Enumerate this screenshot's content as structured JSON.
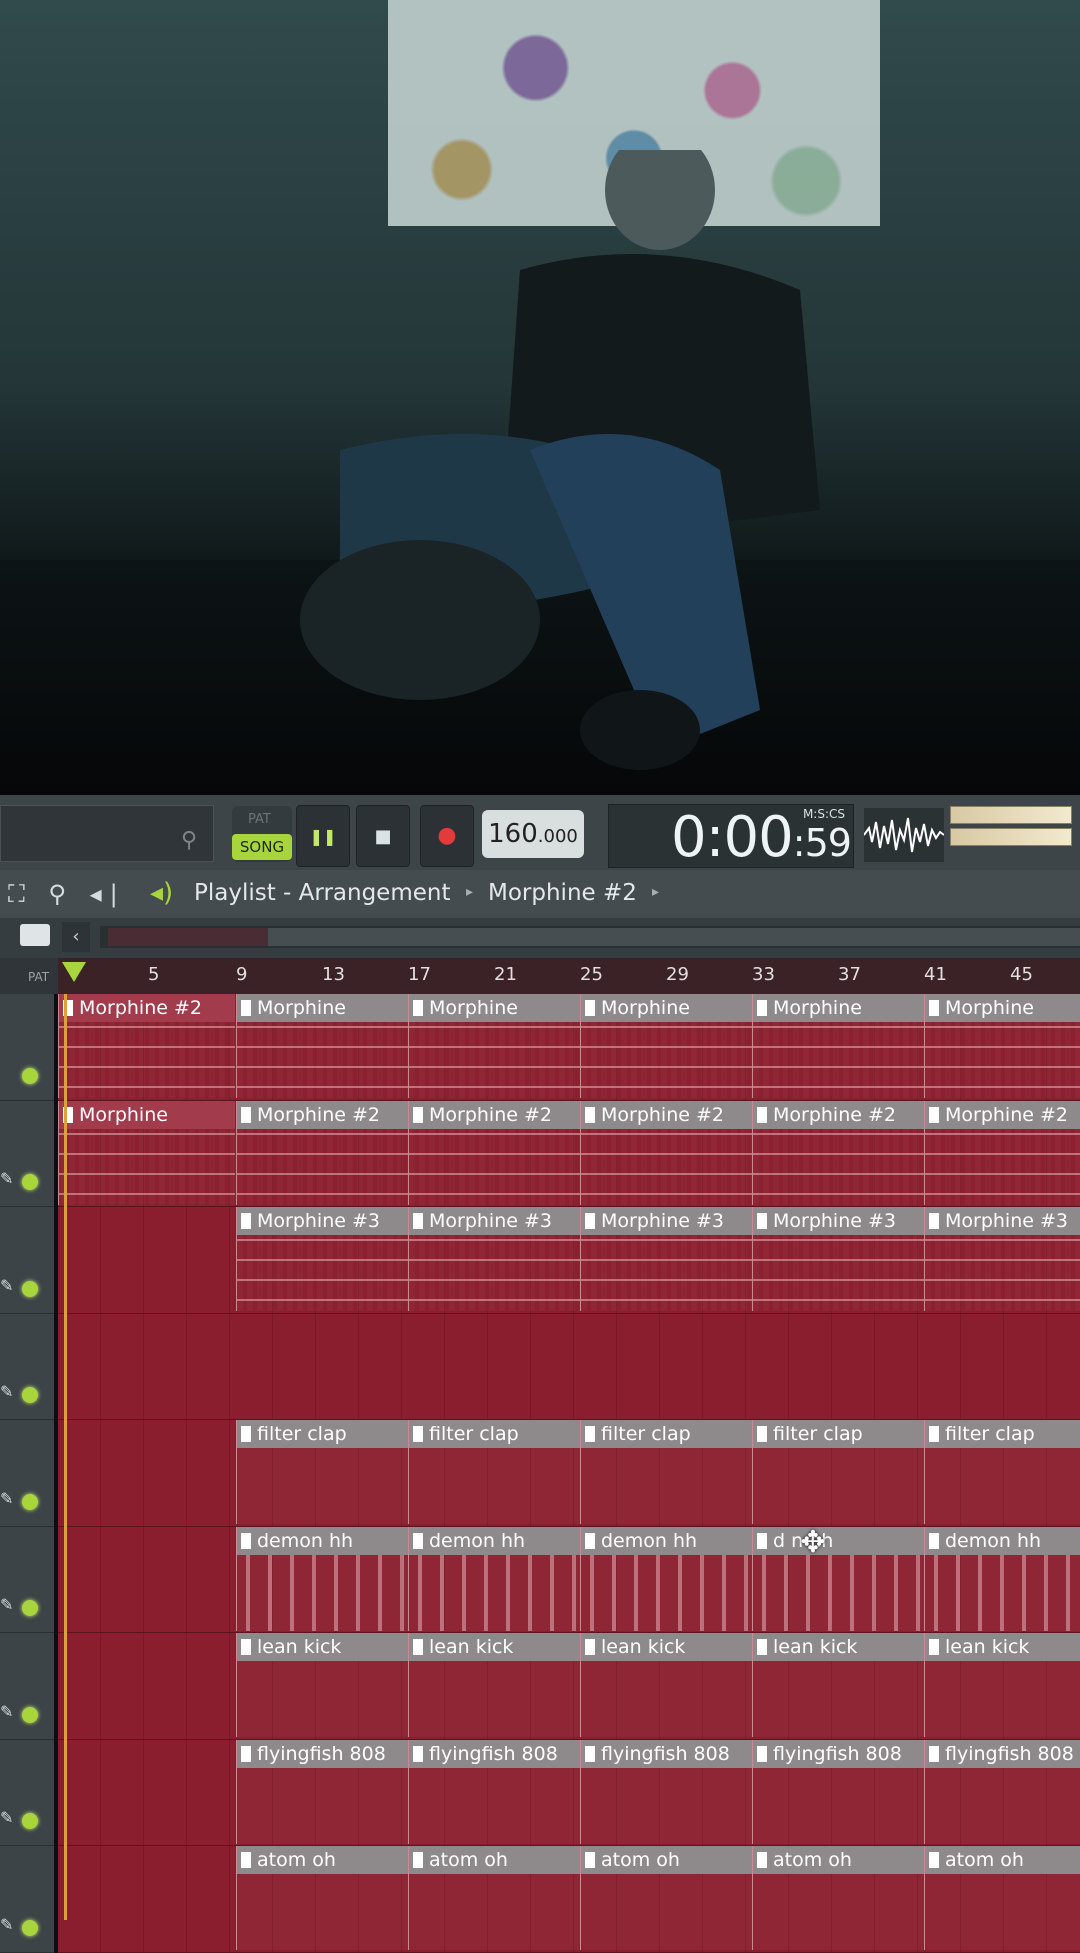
{
  "toolbar": {
    "pat_label": "PAT",
    "song_label": "SONG",
    "pause_symbol": "❚❚",
    "stop_symbol": "■",
    "record_symbol": "●",
    "tempo_int": "160",
    "tempo_dec": ".000",
    "clock_format": "M:S:CS",
    "clock_main": "0:00",
    "clock_cs": ":59"
  },
  "breadcrumb": {
    "title": "Playlist - Arrangement",
    "pattern": "Morphine #2",
    "arrow": "▸"
  },
  "ruler": {
    "left_label": "PAT",
    "marks": [
      "5",
      "9",
      "13",
      "17",
      "21",
      "25",
      "29",
      "33",
      "37",
      "41",
      "45"
    ]
  },
  "tracks": [
    {
      "clips": [
        "Morphine #2",
        "Morphine",
        "Morphine",
        "Morphine",
        "Morphine",
        "Morphine"
      ]
    },
    {
      "clips": [
        "Morphine",
        "Morphine #2",
        "Morphine #2",
        "Morphine #2",
        "Morphine #2",
        "Morphine #2"
      ]
    },
    {
      "clips": [
        "",
        "Morphine #3",
        "Morphine #3",
        "Morphine #3",
        "Morphine #3",
        "Morphine #3"
      ]
    },
    {
      "clips": []
    },
    {
      "clips": [
        "",
        "filter clap",
        "filter clap",
        "filter clap",
        "filter clap",
        "filter clap"
      ]
    },
    {
      "clips": [
        "",
        "demon hh",
        "demon hh",
        "demon hh",
        "d     n hh",
        "demon hh"
      ]
    },
    {
      "clips": [
        "",
        "lean kick",
        "lean kick",
        "lean kick",
        "lean kick",
        "lean kick"
      ]
    },
    {
      "clips": [
        "",
        "flyingfish 808",
        "flyingfish 808",
        "flyingfish 808",
        "flyingfish 808",
        "flyingfish 808"
      ]
    },
    {
      "clips": [
        "",
        "atom oh",
        "atom oh",
        "atom oh",
        "atom oh",
        "atom oh"
      ]
    }
  ],
  "colors": {
    "accent": "#a8d53b",
    "lane": "#8b1e2e",
    "clip_header": "#8e8a8b"
  }
}
